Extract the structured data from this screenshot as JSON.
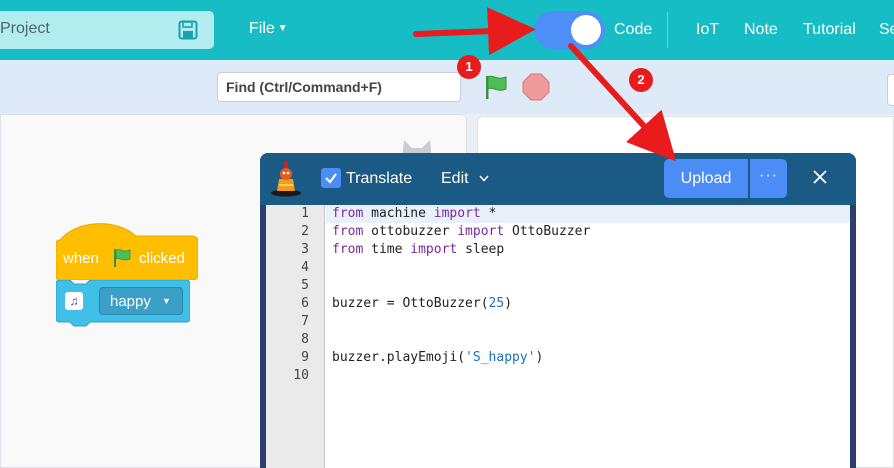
{
  "topbar": {
    "project_label": "Project",
    "file_menu": "File",
    "code_label": "Code",
    "nav": [
      "IoT",
      "Note",
      "Tutorial",
      "Se"
    ]
  },
  "toolbar": {
    "find_placeholder": "Find (Ctrl/Command+F)"
  },
  "blocks": {
    "hat_when": "when",
    "hat_clicked": "clicked",
    "emoji_value": "happy"
  },
  "dialog": {
    "translate_label": "Translate",
    "translate_checked": true,
    "edit_menu": "Edit",
    "upload_label": "Upload",
    "more_label": "···",
    "close_label": "×"
  },
  "editor": {
    "line_numbers": [
      "1",
      "2",
      "3",
      "4",
      "5",
      "6",
      "7",
      "8",
      "9",
      "10"
    ],
    "lines": [
      "from machine import *",
      "from ottobuzzer import OttoBuzzer",
      "from time import sleep",
      "",
      "",
      "buzzer = OttoBuzzer(25)",
      "",
      "",
      "buzzer.playEmoji('S_happy')",
      ""
    ]
  },
  "annotations": {
    "marker_1": "1",
    "marker_2": "2"
  },
  "colors": {
    "topbar": "#17bdc5",
    "toggle": "#4d8ef7",
    "dialog_header": "#1b5a85",
    "hat_block": "#ffbf00",
    "cmd_block": "#40bfe8",
    "marker": "#e81c1c"
  }
}
